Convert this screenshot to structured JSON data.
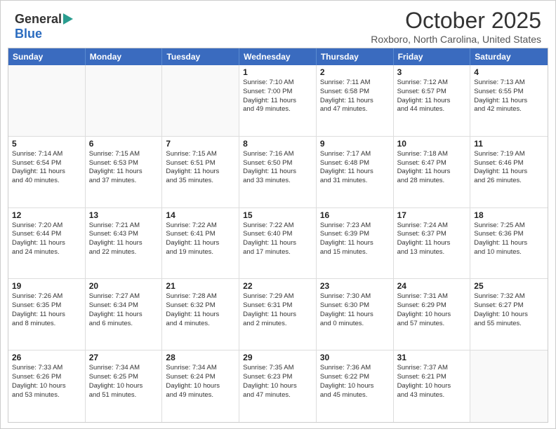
{
  "logo": {
    "general": "General",
    "blue": "Blue"
  },
  "title": "October 2025",
  "location": "Roxboro, North Carolina, United States",
  "weekdays": [
    "Sunday",
    "Monday",
    "Tuesday",
    "Wednesday",
    "Thursday",
    "Friday",
    "Saturday"
  ],
  "weeks": [
    [
      {
        "day": "",
        "info": ""
      },
      {
        "day": "",
        "info": ""
      },
      {
        "day": "",
        "info": ""
      },
      {
        "day": "1",
        "info": "Sunrise: 7:10 AM\nSunset: 7:00 PM\nDaylight: 11 hours\nand 49 minutes."
      },
      {
        "day": "2",
        "info": "Sunrise: 7:11 AM\nSunset: 6:58 PM\nDaylight: 11 hours\nand 47 minutes."
      },
      {
        "day": "3",
        "info": "Sunrise: 7:12 AM\nSunset: 6:57 PM\nDaylight: 11 hours\nand 44 minutes."
      },
      {
        "day": "4",
        "info": "Sunrise: 7:13 AM\nSunset: 6:55 PM\nDaylight: 11 hours\nand 42 minutes."
      }
    ],
    [
      {
        "day": "5",
        "info": "Sunrise: 7:14 AM\nSunset: 6:54 PM\nDaylight: 11 hours\nand 40 minutes."
      },
      {
        "day": "6",
        "info": "Sunrise: 7:15 AM\nSunset: 6:53 PM\nDaylight: 11 hours\nand 37 minutes."
      },
      {
        "day": "7",
        "info": "Sunrise: 7:15 AM\nSunset: 6:51 PM\nDaylight: 11 hours\nand 35 minutes."
      },
      {
        "day": "8",
        "info": "Sunrise: 7:16 AM\nSunset: 6:50 PM\nDaylight: 11 hours\nand 33 minutes."
      },
      {
        "day": "9",
        "info": "Sunrise: 7:17 AM\nSunset: 6:48 PM\nDaylight: 11 hours\nand 31 minutes."
      },
      {
        "day": "10",
        "info": "Sunrise: 7:18 AM\nSunset: 6:47 PM\nDaylight: 11 hours\nand 28 minutes."
      },
      {
        "day": "11",
        "info": "Sunrise: 7:19 AM\nSunset: 6:46 PM\nDaylight: 11 hours\nand 26 minutes."
      }
    ],
    [
      {
        "day": "12",
        "info": "Sunrise: 7:20 AM\nSunset: 6:44 PM\nDaylight: 11 hours\nand 24 minutes."
      },
      {
        "day": "13",
        "info": "Sunrise: 7:21 AM\nSunset: 6:43 PM\nDaylight: 11 hours\nand 22 minutes."
      },
      {
        "day": "14",
        "info": "Sunrise: 7:22 AM\nSunset: 6:41 PM\nDaylight: 11 hours\nand 19 minutes."
      },
      {
        "day": "15",
        "info": "Sunrise: 7:22 AM\nSunset: 6:40 PM\nDaylight: 11 hours\nand 17 minutes."
      },
      {
        "day": "16",
        "info": "Sunrise: 7:23 AM\nSunset: 6:39 PM\nDaylight: 11 hours\nand 15 minutes."
      },
      {
        "day": "17",
        "info": "Sunrise: 7:24 AM\nSunset: 6:37 PM\nDaylight: 11 hours\nand 13 minutes."
      },
      {
        "day": "18",
        "info": "Sunrise: 7:25 AM\nSunset: 6:36 PM\nDaylight: 11 hours\nand 10 minutes."
      }
    ],
    [
      {
        "day": "19",
        "info": "Sunrise: 7:26 AM\nSunset: 6:35 PM\nDaylight: 11 hours\nand 8 minutes."
      },
      {
        "day": "20",
        "info": "Sunrise: 7:27 AM\nSunset: 6:34 PM\nDaylight: 11 hours\nand 6 minutes."
      },
      {
        "day": "21",
        "info": "Sunrise: 7:28 AM\nSunset: 6:32 PM\nDaylight: 11 hours\nand 4 minutes."
      },
      {
        "day": "22",
        "info": "Sunrise: 7:29 AM\nSunset: 6:31 PM\nDaylight: 11 hours\nand 2 minutes."
      },
      {
        "day": "23",
        "info": "Sunrise: 7:30 AM\nSunset: 6:30 PM\nDaylight: 11 hours\nand 0 minutes."
      },
      {
        "day": "24",
        "info": "Sunrise: 7:31 AM\nSunset: 6:29 PM\nDaylight: 10 hours\nand 57 minutes."
      },
      {
        "day": "25",
        "info": "Sunrise: 7:32 AM\nSunset: 6:27 PM\nDaylight: 10 hours\nand 55 minutes."
      }
    ],
    [
      {
        "day": "26",
        "info": "Sunrise: 7:33 AM\nSunset: 6:26 PM\nDaylight: 10 hours\nand 53 minutes."
      },
      {
        "day": "27",
        "info": "Sunrise: 7:34 AM\nSunset: 6:25 PM\nDaylight: 10 hours\nand 51 minutes."
      },
      {
        "day": "28",
        "info": "Sunrise: 7:34 AM\nSunset: 6:24 PM\nDaylight: 10 hours\nand 49 minutes."
      },
      {
        "day": "29",
        "info": "Sunrise: 7:35 AM\nSunset: 6:23 PM\nDaylight: 10 hours\nand 47 minutes."
      },
      {
        "day": "30",
        "info": "Sunrise: 7:36 AM\nSunset: 6:22 PM\nDaylight: 10 hours\nand 45 minutes."
      },
      {
        "day": "31",
        "info": "Sunrise: 7:37 AM\nSunset: 6:21 PM\nDaylight: 10 hours\nand 43 minutes."
      },
      {
        "day": "",
        "info": ""
      }
    ]
  ]
}
